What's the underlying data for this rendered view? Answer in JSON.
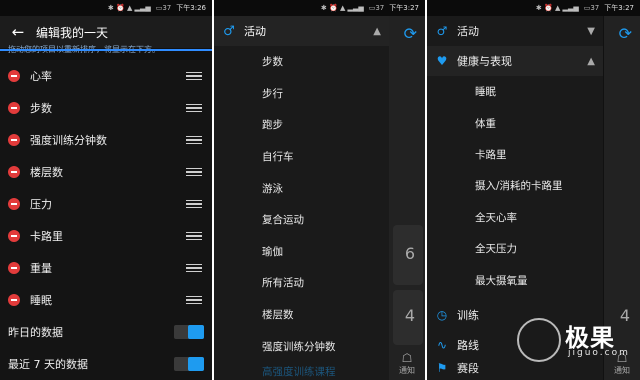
{
  "status": {
    "panel1_time": "下午3:26",
    "panel2_time": "下午3:27",
    "panel3_time": "下午3:27",
    "battery": "37"
  },
  "panel1": {
    "title": "编辑我的一天",
    "hint": "拖动您的项目以重新排序，将显示在下方。",
    "items": [
      "心率",
      "步数",
      "强度训练分钟数",
      "楼层数",
      "压力",
      "卡路里",
      "重量",
      "睡眠"
    ],
    "toggles": [
      {
        "label": "昨日的数据",
        "on": true
      },
      {
        "label": "最近 7 天的数据",
        "on": true
      }
    ]
  },
  "panel2": {
    "header": "活动",
    "items": [
      "步数",
      "步行",
      "跑步",
      "自行车",
      "游泳",
      "复合运动",
      "瑜伽",
      "所有活动",
      "楼层数",
      "强度训练分钟数"
    ],
    "faded_item": "高强度训练课程",
    "bg_numbers": [
      "6",
      "4"
    ],
    "notify": "通知"
  },
  "panel3": {
    "activity": "活动",
    "health": "健康与表现",
    "health_items": [
      "睡眠",
      "体重",
      "卡路里",
      "摄入/消耗的卡路里",
      "全天心率",
      "全天压力",
      "最大摄氧量"
    ],
    "training": "训练",
    "routes": "路线",
    "more": "赛段",
    "notify": "通知"
  },
  "watermark": {
    "brand": "极果",
    "domain": "jiguo.com"
  },
  "colors": {
    "accent": "#1e9bf0",
    "remove": "#e23b3b"
  }
}
